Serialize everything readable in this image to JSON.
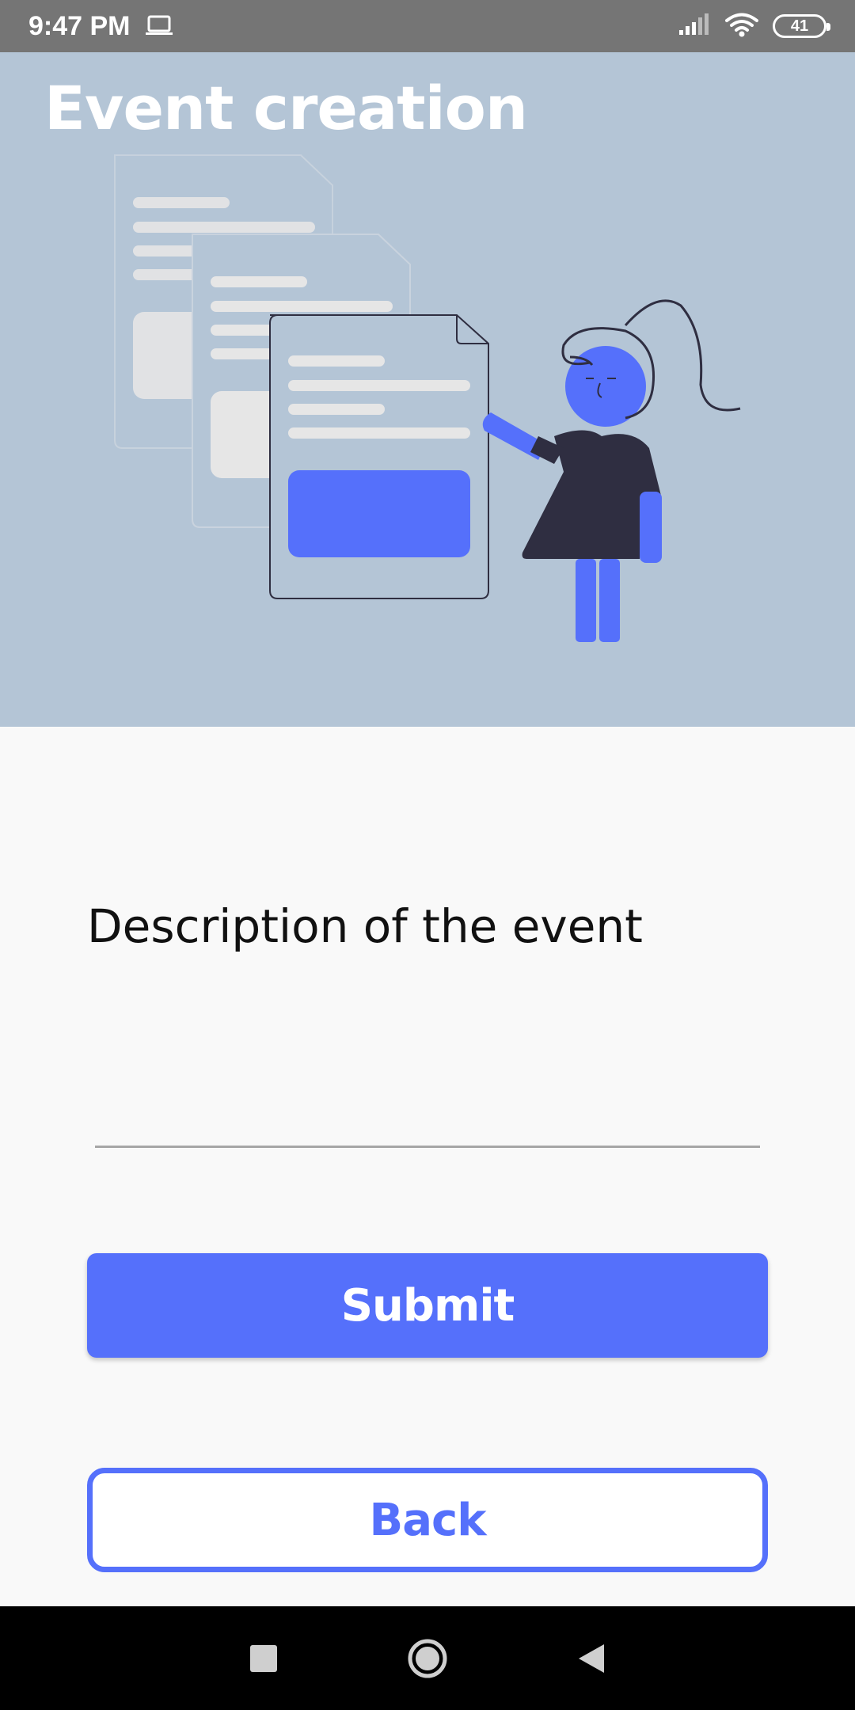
{
  "status_bar": {
    "time": "9:47 PM",
    "battery_level": "41",
    "icons": [
      "laptop-icon",
      "signal-icon",
      "wifi-icon",
      "battery-icon"
    ]
  },
  "header": {
    "title": "Event creation",
    "background_color": "#b4c5d6",
    "illustration": "person-presenting-documents"
  },
  "form": {
    "description_label": "Description of the event",
    "description_value": "",
    "description_placeholder": ""
  },
  "actions": {
    "submit_label": "Submit",
    "back_label": "Back",
    "accent_color": "#5570fb"
  },
  "nav_bar": {
    "items": [
      "recents-square-icon",
      "home-circle-icon",
      "back-triangle-icon"
    ]
  }
}
